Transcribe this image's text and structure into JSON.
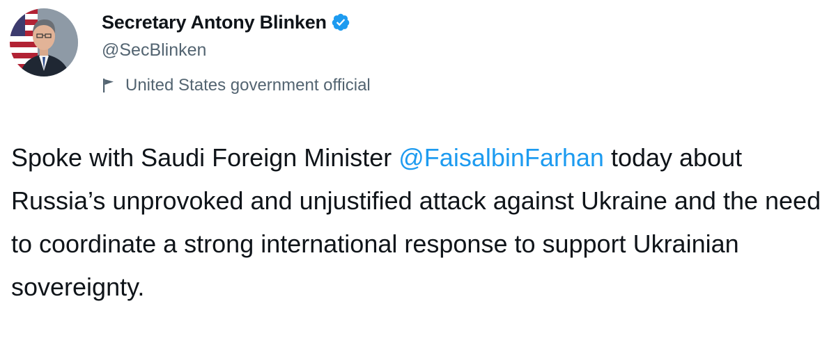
{
  "author": {
    "display_name": "Secretary Antony Blinken",
    "handle": "@SecBlinken",
    "label": "United States government official"
  },
  "tweet": {
    "text_before": "Spoke with Saudi Foreign Minister ",
    "mention": "@FaisalbinFarhan",
    "text_after": " today about Russia’s unprovoked and unjustified attack against Ukraine and the need to coordinate a strong international response to support Ukrainian sovereignty."
  },
  "colors": {
    "link": "#1d9bf0",
    "verified": "#1d9bf0",
    "secondary_text": "#536471"
  },
  "icons": {
    "verified": "verified-badge-icon",
    "label": "flag-icon"
  }
}
